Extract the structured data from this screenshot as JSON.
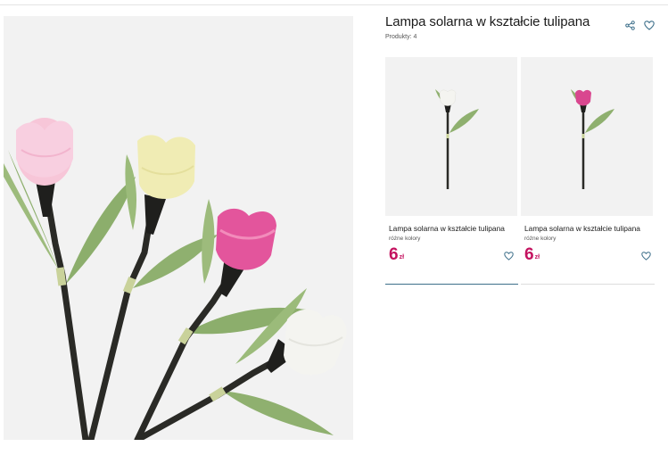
{
  "product": {
    "title": "Lampa solarna w kształcie tulipana",
    "count_label": "Produkty:",
    "count_value": "4"
  },
  "actions": {
    "share_icon": "share-icon",
    "favorite_icon": "heart-icon"
  },
  "variants": [
    {
      "name": "Lampa solarna w kształcie tulipana",
      "subtitle": "różne kolory",
      "price": "6",
      "currency": "zł",
      "flower_color": "#f4f4f0"
    },
    {
      "name": "Lampa solarna w kształcie tulipana",
      "subtitle": "różne kolory",
      "price": "6",
      "currency": "zł",
      "flower_color": "#d9478f"
    }
  ],
  "colors": {
    "price": "#c4125f",
    "accent_line": "#3d6f8a"
  }
}
